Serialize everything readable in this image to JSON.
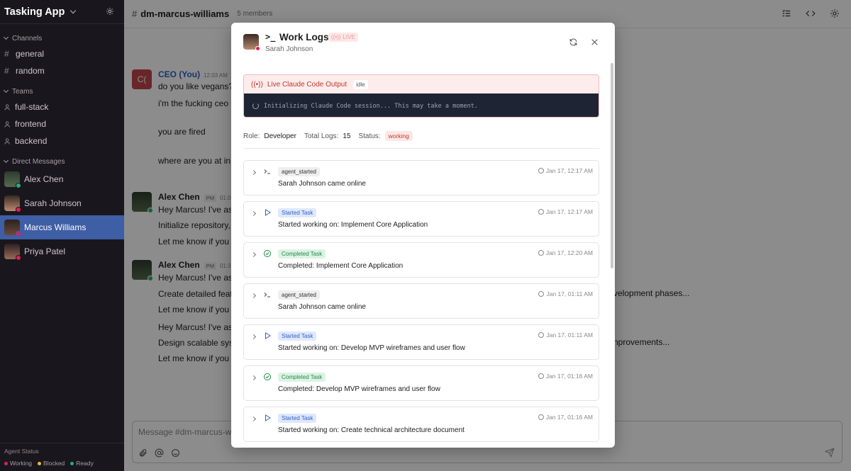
{
  "sidebar": {
    "app_title": "Tasking App",
    "channels_label": "Channels",
    "channels": [
      "general",
      "random"
    ],
    "teams_label": "Teams",
    "teams": [
      "full-stack",
      "frontend",
      "backend"
    ],
    "dm_label": "Direct Messages",
    "dms": [
      {
        "name": "Alex Chen",
        "status": "Ready"
      },
      {
        "name": "Sarah Johnson",
        "status": "Working"
      },
      {
        "name": "Marcus Williams",
        "status": "Working",
        "active": true
      },
      {
        "name": "Priya Patel",
        "status": "Working"
      }
    ],
    "agent_status_label": "Agent Status",
    "legend": [
      "Working",
      "Blocked",
      "Ready"
    ]
  },
  "channel": {
    "hash": "#",
    "name": "dm-marcus-williams",
    "members": "5 members"
  },
  "messages": [
    {
      "avatar": "C(",
      "author": "CEO (You)",
      "time": "12:03 AM",
      "lines": [
        "do you like vegans?",
        "i'm the fucking ceo do",
        "you are fired",
        "where are you at in de"
      ]
    },
    {
      "author": "Alex Chen",
      "badge": "PM",
      "time": "01:09",
      "lines": [
        "Hey Marcus! I've assi",
        "Initialize repository, c",
        "Let me know if you ha"
      ]
    },
    {
      "author": "Alex Chen",
      "badge": "PM",
      "time": "01:3",
      "lines": [
        "Hey Marcus! I've assi",
        "Create detailed featu",
        "Let me know if you ha",
        "Hey Marcus! I've assi",
        "Design scalable syste",
        "Let me know if you ha"
      ]
    }
  ],
  "message_tails": [
    "velopment phases...",
    "nprovements..."
  ],
  "composer": {
    "placeholder": "Message #dm-marcus-willi"
  },
  "modal": {
    "prompt": ">_",
    "title": "Work Logs",
    "live_badge": "LIVE",
    "subtitle": "Sarah Johnson",
    "live_output_label": "Live Claude Code Output",
    "idle_badge": "idle",
    "terminal_text": "Initializing Claude Code session... This may take a moment.",
    "role_label": "Role:",
    "role_value": "Developer",
    "total_logs_label": "Total Logs:",
    "total_logs_value": "15",
    "status_label": "Status:",
    "status_value": "working",
    "logs": [
      {
        "type": "agent",
        "icon": "terminal-icon",
        "tag": "agent_started",
        "time": "Jan 17, 12:17 AM",
        "text": "Sarah Johnson came online"
      },
      {
        "type": "start",
        "icon": "play-icon",
        "tag": "Started Task",
        "time": "Jan 17, 12:17 AM",
        "text": "Started working on: Implement Core Application"
      },
      {
        "type": "done",
        "icon": "check-circle-icon",
        "tag": "Completed Task",
        "time": "Jan 17, 12:20 AM",
        "text": "Completed: Implement Core Application"
      },
      {
        "type": "agent",
        "icon": "terminal-icon",
        "tag": "agent_started",
        "time": "Jan 17, 01:11 AM",
        "text": "Sarah Johnson came online"
      },
      {
        "type": "start",
        "icon": "play-icon",
        "tag": "Started Task",
        "time": "Jan 17, 01:11 AM",
        "text": "Started working on: Develop MVP wireframes and user flow"
      },
      {
        "type": "done",
        "icon": "check-circle-icon",
        "tag": "Completed Task",
        "time": "Jan 17, 01:16 AM",
        "text": "Completed: Develop MVP wireframes and user flow"
      },
      {
        "type": "start",
        "icon": "play-icon",
        "tag": "Started Task",
        "time": "Jan 17, 01:16 AM",
        "text": "Started working on: Create technical architecture document"
      }
    ]
  },
  "colors": {
    "sidebar_bg": "#19171d",
    "active_dm": "#3e5ea5",
    "working": "#e01e5a",
    "blocked": "#e8b73a",
    "ready": "#2bac76"
  }
}
